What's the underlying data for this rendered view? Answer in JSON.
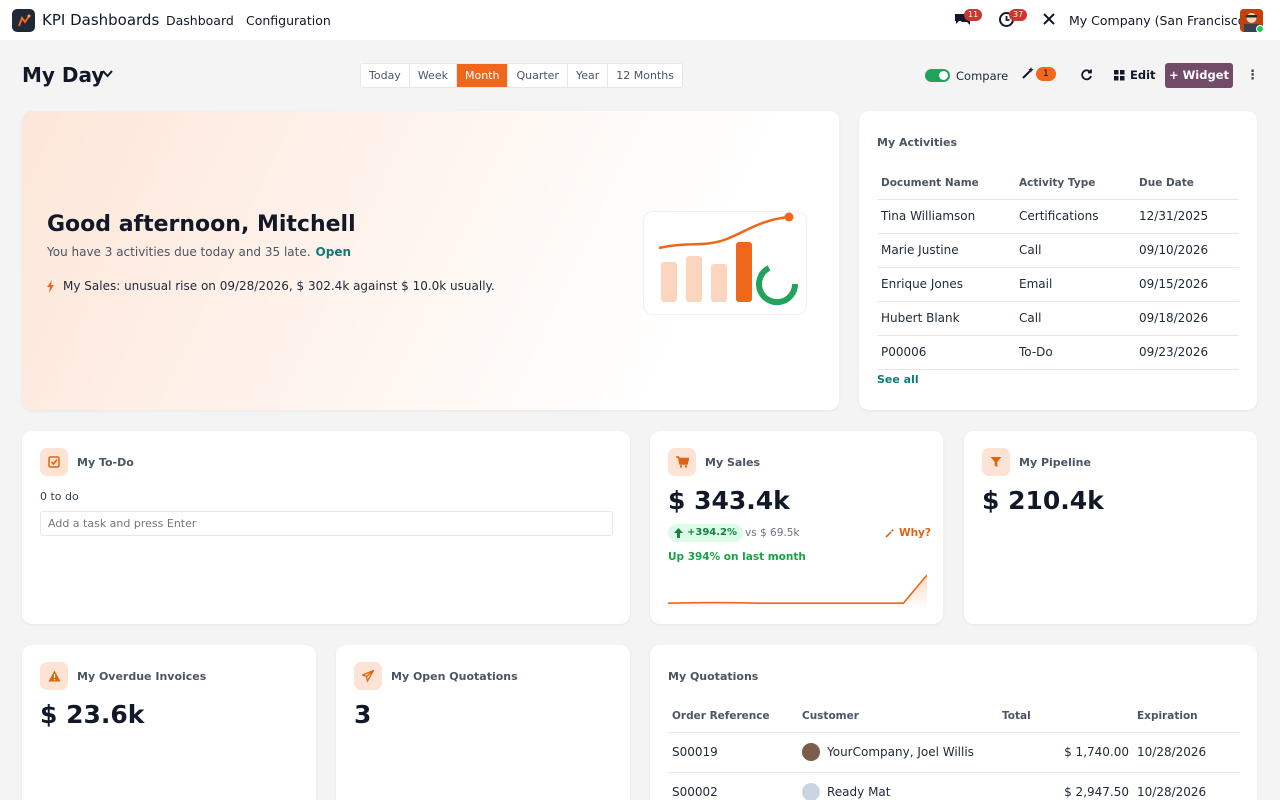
{
  "nav": {
    "app_title": "KPI Dashboards",
    "menu": [
      "Dashboard",
      "Configuration"
    ],
    "chat_count": "11",
    "activity_count": "37",
    "company": "My Company (San Francisco)"
  },
  "controls": {
    "title": "My Day",
    "periods": [
      "Today",
      "Week",
      "Month",
      "Quarter",
      "Year",
      "12 Months"
    ],
    "active_period": "Month",
    "compare_label": "Compare",
    "compare_on": true,
    "magic_count": "1",
    "edit_label": "Edit",
    "widget_label": "+ Widget"
  },
  "hero": {
    "greeting": "Good afternoon, Mitchell",
    "subtitle": "You have 3 activities due today and 35 late.",
    "open_link": "Open",
    "insight": "My Sales: unusual rise on 09/28/2026, $ 302.4k against $ 10.0k usually."
  },
  "activities": {
    "title": "My Activities",
    "columns": [
      "Document Name",
      "Activity Type",
      "Due Date"
    ],
    "rows": [
      [
        "Tina Williamson",
        "Certifications",
        "12/31/2025"
      ],
      [
        "Marie Justine",
        "Call",
        "09/10/2026"
      ],
      [
        "Enrique Jones",
        "Email",
        "09/15/2026"
      ],
      [
        "Hubert Blank",
        "Call",
        "09/18/2026"
      ],
      [
        "P00006",
        "To-Do",
        "09/23/2026"
      ]
    ],
    "see_all": "See all"
  },
  "todo": {
    "title": "My To-Do",
    "count_text": "0 to do",
    "placeholder": "Add a task and press Enter"
  },
  "sales": {
    "title": "My Sales",
    "value": "$ 343.4k",
    "delta": "+394.2%",
    "vs": "vs $ 69.5k",
    "why": "Why?",
    "trend_text": "Up 394% on last month",
    "sparkline": [
      1.2,
      1.3,
      1.4,
      1.3,
      1.2,
      1.2,
      1.2,
      1.2,
      1.2,
      1.2,
      1.2,
      10.0
    ]
  },
  "pipeline": {
    "title": "My Pipeline",
    "value": "$ 210.4k"
  },
  "overdue": {
    "title": "My Overdue Invoices",
    "value": "$ 23.6k"
  },
  "quotations_count": {
    "title": "My Open Quotations",
    "value": "3"
  },
  "quotations": {
    "title": "My Quotations",
    "columns": [
      "Order Reference",
      "Customer",
      "Total",
      "Expiration"
    ],
    "rows": [
      [
        "S00019",
        "YourCompany, Joel Willis",
        "$ 1,740.00",
        "10/28/2026"
      ],
      [
        "S00002",
        "Ready Mat",
        "$ 2,947.50",
        "10/28/2026"
      ]
    ]
  },
  "colors": {
    "accent": "#f0661a",
    "brand": "#714b67",
    "success": "#22a35b",
    "link": "#0f7a7a"
  }
}
